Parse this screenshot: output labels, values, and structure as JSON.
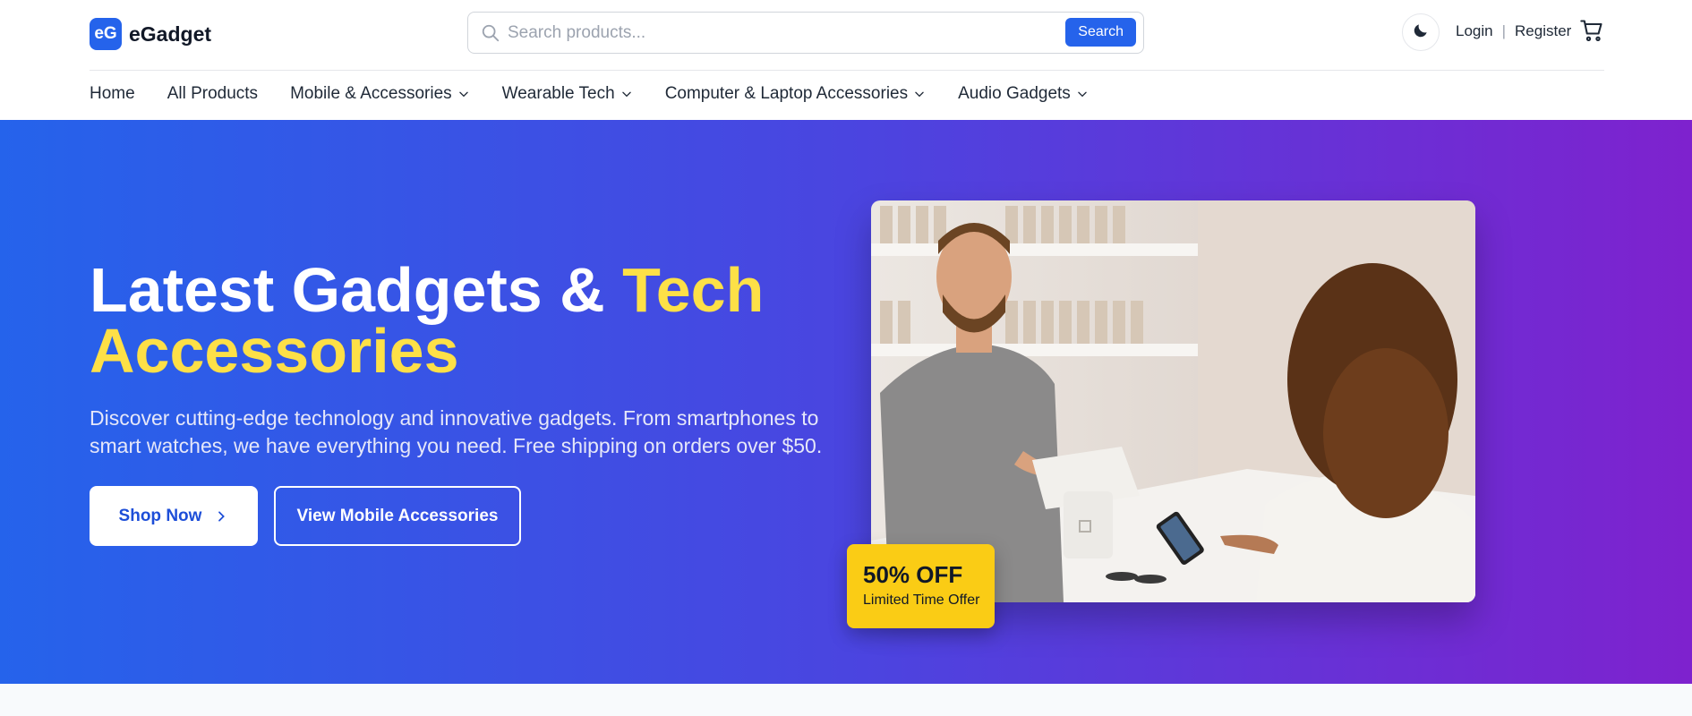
{
  "brand": {
    "badge": "eG",
    "name": "eGadget",
    "color": "#2563eb"
  },
  "search": {
    "placeholder": "Search products...",
    "button_label": "Search"
  },
  "auth": {
    "login": "Login",
    "separator": "|",
    "register": "Register"
  },
  "icons": {
    "search": "search-icon",
    "theme": "moon-icon",
    "cart": "cart-icon",
    "chevron": "chevron-down-icon",
    "arrow": "chevron-right-icon"
  },
  "nav": {
    "items": [
      {
        "label": "Home",
        "dropdown": false
      },
      {
        "label": "All Products",
        "dropdown": false
      },
      {
        "label": "Mobile & Accessories",
        "dropdown": true
      },
      {
        "label": "Wearable Tech",
        "dropdown": true
      },
      {
        "label": "Computer & Laptop Accessories",
        "dropdown": true
      },
      {
        "label": "Audio Gadgets",
        "dropdown": true
      }
    ]
  },
  "hero": {
    "title_part1": "Latest Gadgets & ",
    "title_accent1": "Tech",
    "title_accent2": "Accessories",
    "description": "Discover cutting-edge technology and innovative gadgets. From smartphones to smart watches, we have everything you need. Free shipping on orders over $50.",
    "primary_button": "Shop Now",
    "secondary_button": "View Mobile Accessories",
    "accent_color": "#fde047",
    "gradient": [
      "#2563eb",
      "#7e22ce"
    ]
  },
  "promo": {
    "title": "50% OFF",
    "subtitle": "Limited Time Offer",
    "color": "#facc15"
  }
}
